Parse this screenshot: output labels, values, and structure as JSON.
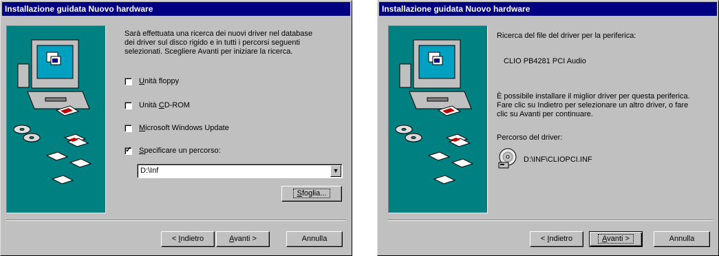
{
  "left_dialog": {
    "title": "Installazione guidata Nuovo hardware",
    "description_lines": [
      "Sarà effettuata una ricerca dei nuovi driver nel database",
      "dei driver sul disco rigido e in tutti i percorsi seguenti",
      "selezionati. Scegliere Avanti per iniziare la ricerca."
    ],
    "options": [
      {
        "label": "Unità floppy",
        "checked": false
      },
      {
        "label": "Unità CD-ROM",
        "checked": false
      },
      {
        "label": "Microsoft Windows Update",
        "checked": false
      },
      {
        "label": "Specificare un percorso:",
        "checked": true
      }
    ],
    "path_value": "D:\\Inf",
    "browse_label": "Sfoglia...",
    "back_label": "< Indietro",
    "next_label": "Avanti >",
    "cancel_label": "Annulla"
  },
  "right_dialog": {
    "title": "Installazione guidata Nuovo hardware",
    "search_label": "Ricerca del file del driver per la periferica:",
    "device_name": "CLIO PB4281 PCI Audio",
    "info_lines": [
      "È possibile installare il miglior driver per questa periferica.",
      "Fare clic su Indietro per selezionare un altro driver, o fare",
      "clic su Avanti per continuare."
    ],
    "path_label": "Percorso del driver:",
    "driver_path": "D:\\INF\\CLIOPCI.INF",
    "back_label": "< Indietro",
    "next_label": "Avanti >",
    "cancel_label": "Annulla"
  },
  "colors": {
    "titlebar": "#000080",
    "dialog_bg": "#c0c0c0",
    "art_bg": "#008080"
  }
}
